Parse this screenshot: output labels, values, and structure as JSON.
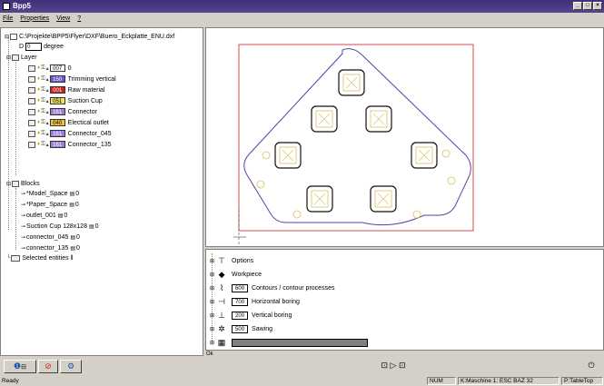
{
  "window": {
    "title": "Bpp5"
  },
  "menu": {
    "file": "File",
    "properties": "Properties",
    "view": "View",
    "help": "?"
  },
  "tree": {
    "root_path": "C:\\Projekte\\BPP5\\Flyer\\DXF\\Buero_Eckplatte_ENU.dxf",
    "rotation_label": "D",
    "rotation_value": "0",
    "rotation_unit": "degree",
    "layer_header": "Layer",
    "layers": [
      {
        "code": "007",
        "name": "0",
        "color": "#ffffff",
        "text_color": "#000000"
      },
      {
        "code": "150",
        "name": "Trimming vertical",
        "color": "#6a5acd",
        "text_color": "#ffffff"
      },
      {
        "code": "001",
        "name": "Raw material",
        "color": "#cc2222",
        "text_color": "#ffffff"
      },
      {
        "code": "051",
        "name": "Suction Cup",
        "color": "#f0e060",
        "text_color": "#000000"
      },
      {
        "code": "161",
        "name": "Connector",
        "color": "#9b7fd4",
        "text_color": "#ffffff"
      },
      {
        "code": "040",
        "name": "Electical outlet",
        "color": "#f0c040",
        "text_color": "#000000"
      },
      {
        "code": "161",
        "name": "Connector_045",
        "color": "#9b7fd4",
        "text_color": "#ffffff"
      },
      {
        "code": "161",
        "name": "Connector_135",
        "color": "#9b7fd4",
        "text_color": "#ffffff"
      }
    ],
    "blocks_header": "Blocks",
    "blocks": [
      {
        "name": "*Model_Space",
        "count": "0"
      },
      {
        "name": "*Paper_Space",
        "count": "0"
      },
      {
        "name": "outlet_001",
        "count": "0"
      },
      {
        "name": "Suction Cup 128x128",
        "count": "0"
      },
      {
        "name": "connector_045",
        "count": "0"
      },
      {
        "name": "connector_135",
        "count": "0"
      }
    ],
    "selected": "Selected entities"
  },
  "operations": [
    {
      "code": "",
      "label": "Options",
      "icon": "options-icon"
    },
    {
      "code": "",
      "label": "Workpiece",
      "icon": "workpiece-icon"
    },
    {
      "code": "600",
      "label": "Contours / contour processes",
      "icon": "contour-icon"
    },
    {
      "code": "700",
      "label": "Horizontal boring",
      "icon": "horizontal-drill-icon"
    },
    {
      "code": "200",
      "label": "Vertical boring",
      "icon": "vertical-drill-icon"
    },
    {
      "code": "500",
      "label": "Sawing",
      "icon": "saw-icon"
    },
    {
      "code": "",
      "label": "",
      "icon": "special-icon"
    }
  ],
  "ok_text": "Ok",
  "status": {
    "ready": "Ready",
    "num": "NUM",
    "machine": "K:Maschine 1: ESC BAZ 32",
    "table": "P:TableTop"
  }
}
